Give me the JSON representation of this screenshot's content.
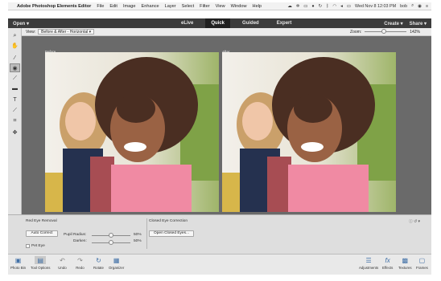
{
  "menubar": {
    "app_name": "Adobe Photoshop Elements Editor",
    "items": [
      "File",
      "Edit",
      "Image",
      "Enhance",
      "Layer",
      "Select",
      "Filter",
      "View",
      "Window",
      "Help"
    ],
    "clock": "Wed Nov 8  12:03 PM",
    "user": "bob"
  },
  "topbar": {
    "open_label": "Open",
    "modes": [
      "eLive",
      "Quick",
      "Guided",
      "Expert"
    ],
    "active_mode": "Quick",
    "create_label": "Create",
    "share_label": "Share"
  },
  "options": {
    "view_label": "View:",
    "view_value": "Before & After - Horizontal",
    "zoom_label": "Zoom:",
    "zoom_value": "142%",
    "zoom_level": 0.45
  },
  "canvas": {
    "before_label": "Before",
    "after_label": "After"
  },
  "tool_options": {
    "section_title": "Red Eye Removal",
    "auto_correct_label": "Auto Correct",
    "pet_eye_label": "Pet Eye",
    "pupil_radius_label": "Pupil Radius:",
    "pupil_radius_value": "50%",
    "darken_label": "Darken:",
    "darken_value": "50%",
    "closed_eye_title": "Closed Eye Correction",
    "open_closed_eyes_label": "Open Closed Eyes..."
  },
  "bottombar": {
    "left_items": [
      "Photo Bin",
      "Tool Options",
      "Undo",
      "Redo",
      "Rotate",
      "Organizer"
    ],
    "right_items": [
      "Adjustments",
      "Effects",
      "Textures",
      "Frames"
    ]
  },
  "colors": {
    "topbar": "#3c3c3c",
    "canvas": "#6a6a6a",
    "accent": "#3f6fa6"
  }
}
